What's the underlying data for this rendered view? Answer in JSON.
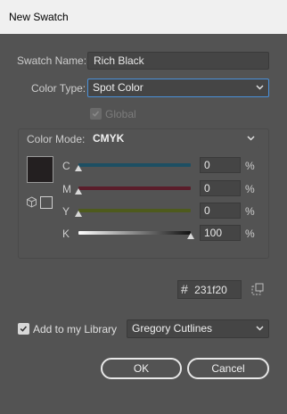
{
  "window": {
    "title": "New Swatch"
  },
  "swatch_name": {
    "label": "Swatch Name:",
    "value": "Rich Black"
  },
  "color_type": {
    "label": "Color Type:",
    "value": "Spot Color"
  },
  "global": {
    "label": "Global",
    "checked": true,
    "disabled": true
  },
  "color_mode": {
    "label": "Color Mode:",
    "value": "CMYK"
  },
  "channels": [
    {
      "label": "C",
      "value": "0",
      "unit": "%",
      "fraction": 0,
      "color": "#1d4f63"
    },
    {
      "label": "M",
      "value": "0",
      "unit": "%",
      "fraction": 0,
      "color": "#5a1d2a"
    },
    {
      "label": "Y",
      "value": "0",
      "unit": "%",
      "fraction": 0,
      "color": "#4e5a1d"
    },
    {
      "label": "K",
      "value": "100",
      "unit": "%",
      "fraction": 1,
      "color": "#111111"
    }
  ],
  "hex": {
    "symbol": "#",
    "value": "231f20"
  },
  "add_to_library": {
    "label": "Add to my Library",
    "checked": true
  },
  "library": {
    "value": "Gregory Cutlines"
  },
  "buttons": {
    "ok": "OK",
    "cancel": "Cancel"
  },
  "colors": {
    "swatch": "#231f20",
    "focus_border": "#4a90d9",
    "dialog_bg": "#535353"
  }
}
